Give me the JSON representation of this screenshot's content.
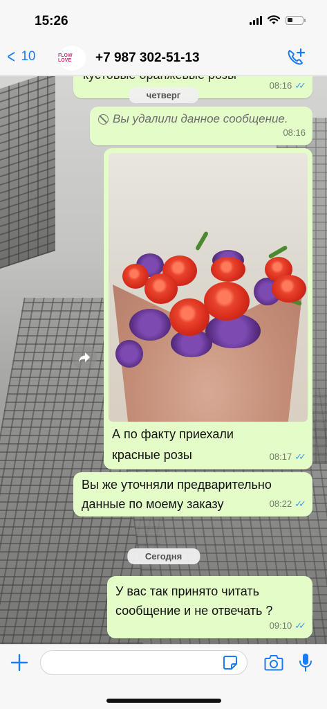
{
  "status_bar": {
    "time": "15:26"
  },
  "header": {
    "back_count": "10",
    "avatar_text": "FLOW LOVE",
    "contact_name": "+7 987 302-51-13"
  },
  "messages": {
    "partial": {
      "text": "кустовые оранжевые розы",
      "time": "08:16"
    },
    "date_thursday": "четверг",
    "deleted": {
      "text": "Вы удалили данное сообщение.",
      "time": "08:16"
    },
    "photo": {
      "caption": "А по факту приехали красные розы",
      "time": "08:17"
    },
    "msg2": {
      "text": "Вы же уточняли предварительно данные по моему заказу",
      "time": "08:22"
    },
    "date_today": "Сегодня",
    "msg3": {
      "text": "У вас так принято читать сообщение и не отвечать ?",
      "time": "09:10"
    }
  },
  "input_bar": {
    "placeholder": ""
  },
  "colors": {
    "accent": "#1a7cf4",
    "bubble": "#e4fcc8",
    "ticks": "#3a9be8"
  }
}
